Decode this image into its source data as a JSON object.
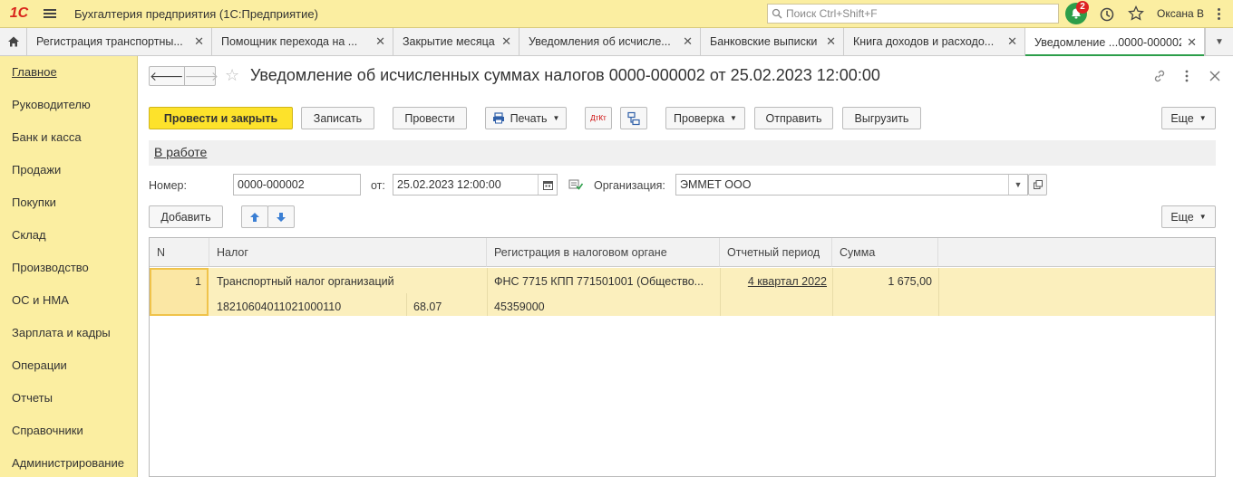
{
  "topbar": {
    "logo": "1С",
    "app_title": "Бухгалтерия предприятия  (1С:Предприятие)",
    "search_placeholder": "Поиск Ctrl+Shift+F",
    "notifications_count": "2",
    "user_name": "Оксана В"
  },
  "tabs": [
    {
      "label": "Регистрация транспортны..."
    },
    {
      "label": "Помощник перехода на ..."
    },
    {
      "label": "Закрытие месяца"
    },
    {
      "label": "Уведомления об исчисле..."
    },
    {
      "label": "Банковские выписки"
    },
    {
      "label": "Книга доходов и расходо..."
    },
    {
      "label": "Уведомление ...0000-000002"
    }
  ],
  "sidebar": {
    "items": [
      {
        "label": "Главное"
      },
      {
        "label": "Руководителю"
      },
      {
        "label": "Банк и касса"
      },
      {
        "label": "Продажи"
      },
      {
        "label": "Покупки"
      },
      {
        "label": "Склад"
      },
      {
        "label": "Производство"
      },
      {
        "label": "ОС и НМА"
      },
      {
        "label": "Зарплата и кадры"
      },
      {
        "label": "Операции"
      },
      {
        "label": "Отчеты"
      },
      {
        "label": "Справочники"
      },
      {
        "label": "Администрирование"
      }
    ]
  },
  "document": {
    "title": "Уведомление об исчисленных суммах налогов 0000-000002 от 25.02.2023 12:00:00",
    "status": "В работе"
  },
  "toolbar": {
    "post_close": "Провести и закрыть",
    "save": "Записать",
    "post": "Провести",
    "print": "Печать",
    "dt_kt": "ДтКт",
    "check": "Проверка",
    "send": "Отправить",
    "export": "Выгрузить",
    "more": "Еще"
  },
  "form": {
    "number_label": "Номер:",
    "number_value": "0000-000002",
    "date_label": "от:",
    "date_value": "25.02.2023 12:00:00",
    "org_label": "Организация:",
    "org_value": "ЭММЕТ ООО"
  },
  "table_toolbar": {
    "add": "Добавить",
    "more": "Еще"
  },
  "table": {
    "columns": [
      "N",
      "Налог",
      "Регистрация в налоговом органе",
      "Отчетный период",
      "Сумма"
    ],
    "rows": [
      {
        "n": "1",
        "tax": "Транспортный налог организаций",
        "kbk": "18210604011021000110",
        "account": "68.07",
        "registration": "ФНС 7715 КПП 771501001 (Общество...",
        "oktmo": "45359000",
        "period": "4 квартал 2022",
        "sum": "1 675,00"
      }
    ]
  }
}
